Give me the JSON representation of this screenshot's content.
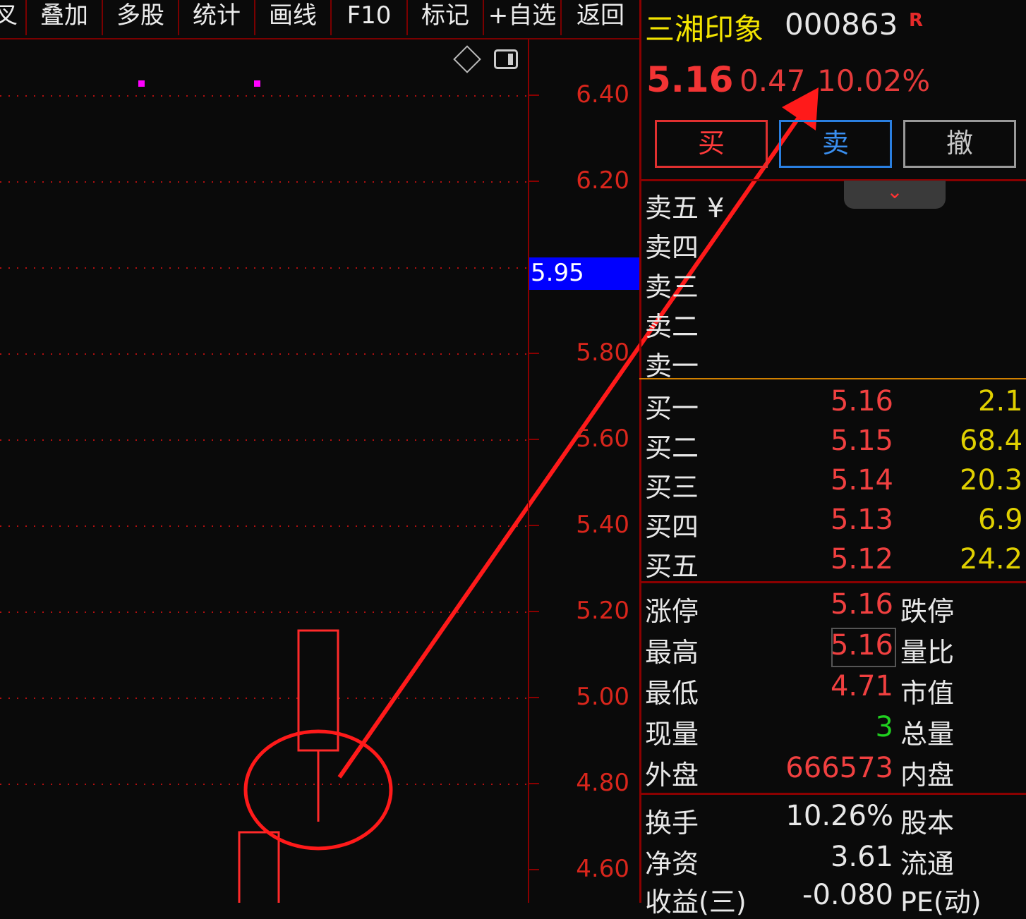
{
  "toolbar": {
    "items": [
      "叉",
      "叠加",
      "多股",
      "统计",
      "画线",
      "F10",
      "标记",
      "+自选",
      "返回"
    ]
  },
  "chart": {
    "y_ticks": [
      "6.40",
      "6.20",
      "5.80",
      "5.60",
      "5.40",
      "5.20",
      "5.00",
      "4.80",
      "4.60"
    ],
    "cursor_price": "5.95",
    "colors": {
      "up": "#ff2a2a",
      "grid": "#b01010",
      "marker": "#ff00ff",
      "cursor_bg": "#0000ff"
    },
    "icons": [
      "diamond-icon",
      "panel-toggle-icon"
    ]
  },
  "stock": {
    "name": "三湘印象",
    "code": "000863",
    "flag": "R",
    "price": "5.16",
    "change": "0.47",
    "change_pct": "10.02%"
  },
  "trade_buttons": {
    "buy": "买",
    "sell": "卖",
    "cancel": "撤"
  },
  "ask_rows": [
    "卖五 ¥",
    "卖四",
    "卖三",
    "卖二",
    "卖一"
  ],
  "bid_rows": [
    {
      "label": "买一",
      "price": "5.16",
      "vol": "2.1"
    },
    {
      "label": "买二",
      "price": "5.15",
      "vol": "68.4"
    },
    {
      "label": "买三",
      "price": "5.14",
      "vol": "20.3"
    },
    {
      "label": "买四",
      "price": "5.13",
      "vol": "6.9"
    },
    {
      "label": "买五",
      "price": "5.12",
      "vol": "24.2"
    }
  ],
  "stats": [
    {
      "label": "涨停",
      "value": "5.16",
      "label2": "跌停"
    },
    {
      "label": "最高",
      "value": "5.16",
      "label2": "量比"
    },
    {
      "label": "最低",
      "value": "4.71",
      "label2": "市值"
    },
    {
      "label": "现量",
      "value": "3",
      "label2": "总量"
    },
    {
      "label": "外盘",
      "value": "666573",
      "label2": "内盘"
    }
  ],
  "stats2": [
    {
      "label": "换手",
      "value": "10.26%",
      "label2": "股本"
    },
    {
      "label": "净资",
      "value": "3.61",
      "label2": "流通"
    },
    {
      "label": "收益(三)",
      "value": "-0.080",
      "label2": "PE(动)"
    }
  ]
}
